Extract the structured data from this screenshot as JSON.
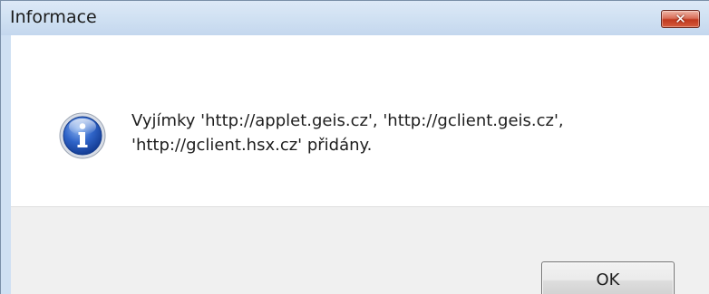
{
  "dialog": {
    "title": "Informace",
    "message": "Vyjímky 'http://applet.geis.cz', 'http://gclient.geis.cz',\n'http://gclient.hsx.cz' přidány.",
    "ok_label": "OK",
    "close_label": "✕",
    "icon": "info-icon"
  }
}
